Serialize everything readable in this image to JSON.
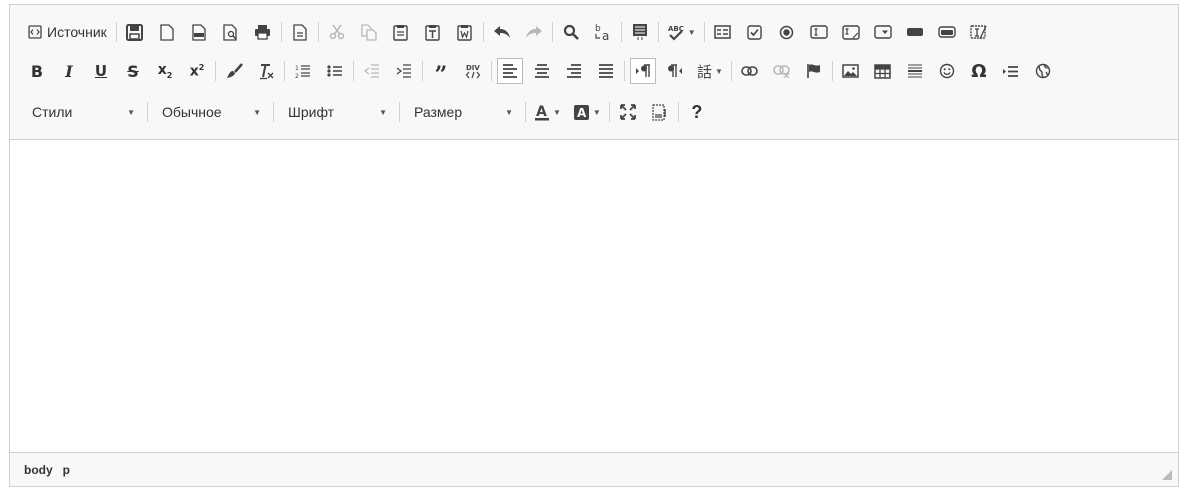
{
  "toolbar": {
    "source_label": "Источник",
    "format_combos": {
      "styles": "Стили",
      "format": "Обычное",
      "font": "Шрифт",
      "size": "Размер"
    },
    "help_label": "?"
  },
  "statusbar": {
    "path": [
      "body",
      "p"
    ]
  },
  "colors": {
    "toolbar_bg": "#f8f8f8",
    "border": "#d1d1d1",
    "icon": "#444444",
    "accent_underline": "#e0e0e0"
  }
}
